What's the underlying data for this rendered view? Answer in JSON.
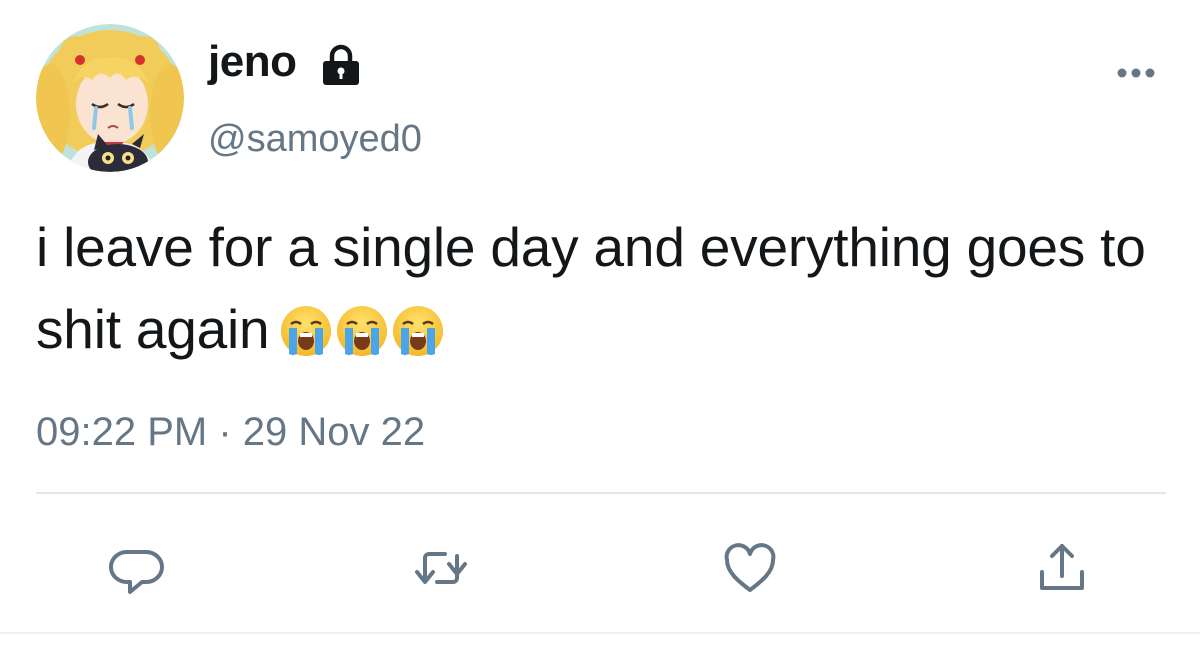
{
  "user": {
    "display_name": "jeno",
    "handle": "@samoyed0",
    "protected": true
  },
  "tweet": {
    "text": "i leave for a single day and everything goes to shit again",
    "emojis": [
      "😭",
      "😭",
      "😭"
    ],
    "timestamp": "09:22 PM · 29 Nov 22"
  },
  "icons": {
    "lock": "lock-icon",
    "more": "more-horizontal-icon",
    "reply": "reply-icon",
    "retweet": "retweet-icon",
    "like": "heart-icon",
    "share": "share-icon"
  },
  "colors": {
    "text_primary": "#14171a",
    "text_secondary": "#657786",
    "divider": "#e1e8ed"
  }
}
